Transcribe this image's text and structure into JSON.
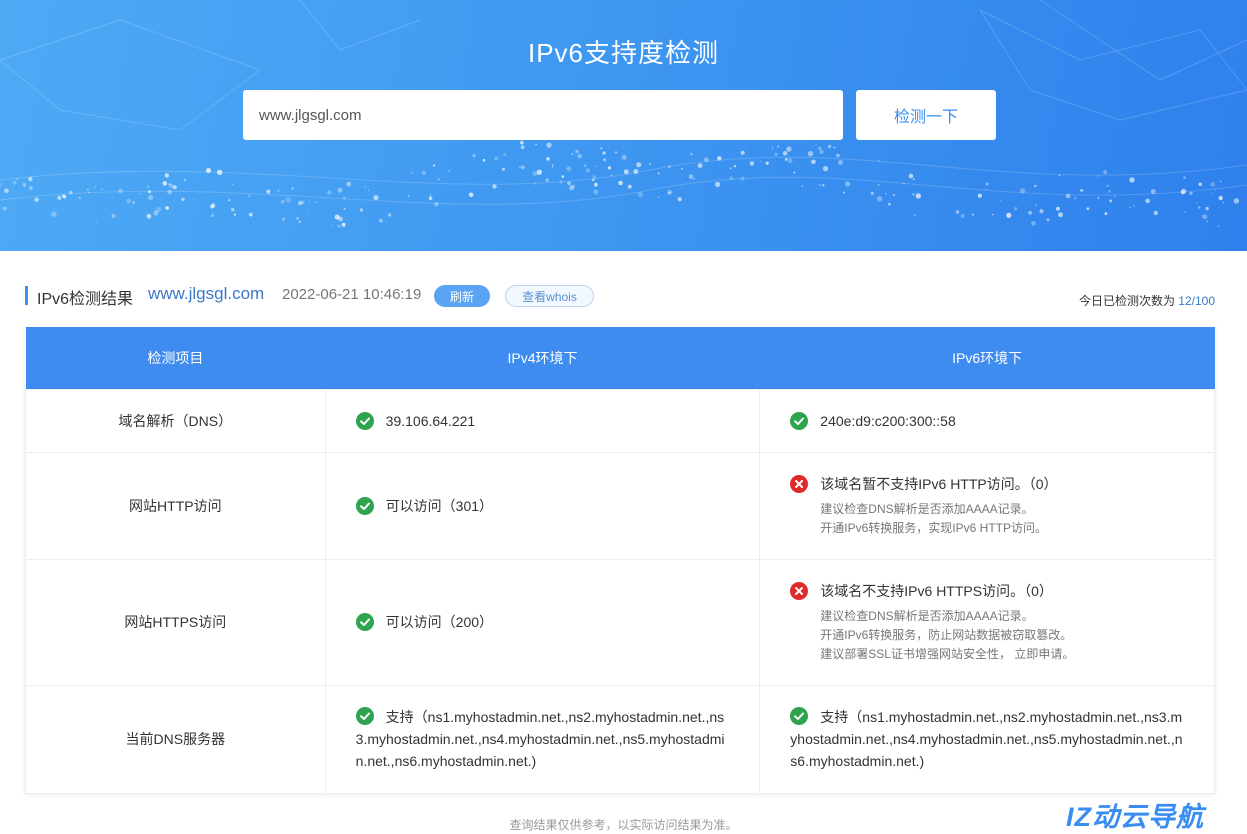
{
  "hero": {
    "title": "IPv6支持度检测",
    "search_value": "www.jlgsgl.com",
    "search_button": "检测一下"
  },
  "result": {
    "title": "IPv6检测结果",
    "domain": "www.jlgsgl.com",
    "time": "2022-06-21 10:46:19",
    "refresh_label": "刷新",
    "whois_label": "查看whois",
    "count_label": "今日已检测次数为",
    "count_value": "12/100"
  },
  "table": {
    "headers": [
      "检测项目",
      "IPv4环境下",
      "IPv6环境下"
    ],
    "rows": [
      {
        "label": "域名解析（DNS）",
        "v4": {
          "status": "ok",
          "text": "39.106.64.221"
        },
        "v6": {
          "status": "ok",
          "text": "240e:d9:c200:300::58"
        }
      },
      {
        "label": "网站HTTP访问",
        "v4": {
          "status": "ok",
          "text": "可以访问（301）"
        },
        "v6": {
          "status": "error",
          "text": "该域名暂不支持IPv6 HTTP访问。（0）",
          "tips": [
            "建议检查DNS解析是否添加AAAA记录。",
            "开通IPv6转换服务，实现IPv6 HTTP访问。"
          ]
        }
      },
      {
        "label": "网站HTTPS访问",
        "v4": {
          "status": "ok",
          "text": "可以访问（200）"
        },
        "v6": {
          "status": "error",
          "text": "该域名不支持IPv6 HTTPS访问。（0）",
          "tips": [
            "建议检查DNS解析是否添加AAAA记录。",
            "开通IPv6转换服务，防止网站数据被窃取篡改。",
            "建议部署SSL证书增强网站安全性， 立即申请。"
          ]
        }
      },
      {
        "label": "当前DNS服务器",
        "v4": {
          "status": "ok",
          "text": "支持（ns1.myhostadmin.net.,ns2.myhostadmin.net.,ns3.myhostadmin.net.,ns4.myhostadmin.net.,ns5.myhostadmin.net.,ns6.myhostadmin.net.)"
        },
        "v6": {
          "status": "ok",
          "text": "支持（ns1.myhostadmin.net.,ns2.myhostadmin.net.,ns3.myhostadmin.net.,ns4.myhostadmin.net.,ns5.myhostadmin.net.,ns6.myhostadmin.net.)"
        }
      }
    ]
  },
  "footer_note": "查询结果仅供参考，以实际访问结果为准。",
  "watermark": "IZ动云导航",
  "colors": {
    "primary": "#3e8cef",
    "ok": "#2ea44f",
    "error": "#e02a2a",
    "link": "#3b78c9"
  },
  "icons": {
    "ok": "check-circle-icon",
    "error": "error-circle-icon"
  }
}
